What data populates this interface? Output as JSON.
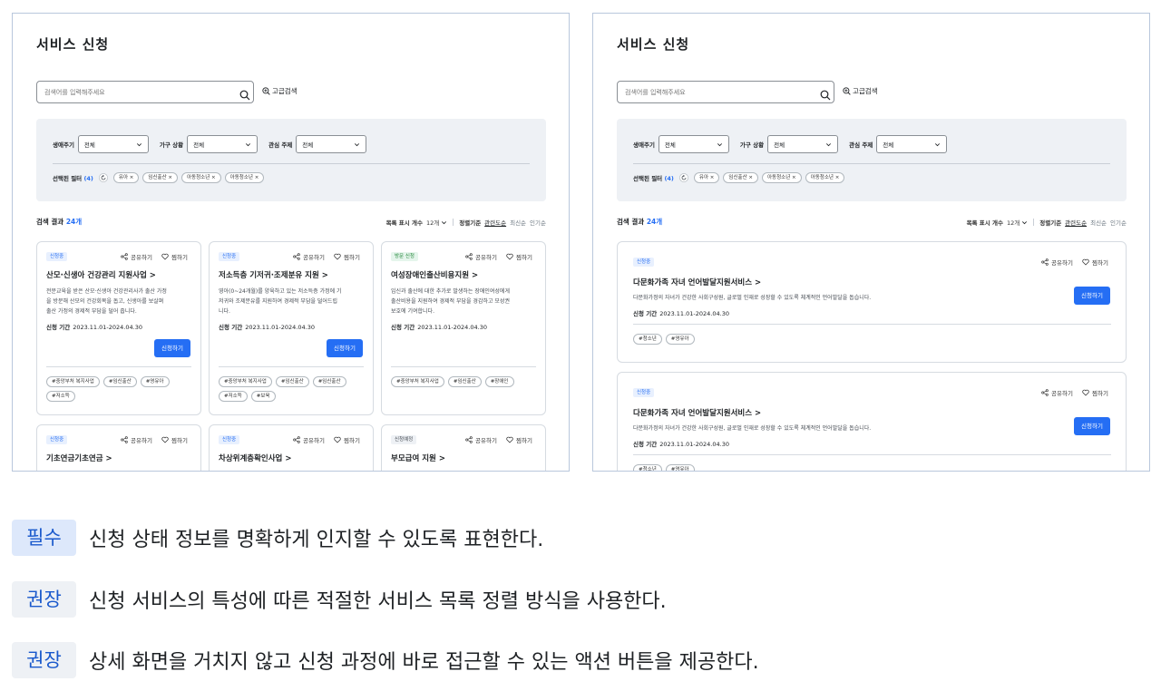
{
  "left": {
    "title": "서비스 신청",
    "search_placeholder": "검색어를 입력해주세요",
    "advanced_search": "고급검색",
    "filters": [
      {
        "label": "생애주기",
        "value": "전체"
      },
      {
        "label": "가구 상황",
        "value": "전체"
      },
      {
        "label": "관심 주제",
        "value": "전체"
      }
    ],
    "selected_label": "선택된 필터",
    "selected_count": "(4)",
    "chips": [
      "유아 ×",
      "임신출산 ×",
      "아동청소년 ×",
      "아동청소년 ×"
    ],
    "result_prefix": "검색 결과",
    "result_count": "24개",
    "per_page_label": "목록 표시 개수",
    "per_page_value": "12개",
    "sort_label": "정렬기준",
    "sort_options": [
      "관련도순",
      "최신순",
      "인기순"
    ],
    "share_label": "공유하기",
    "like_label": "찜하기",
    "apply_label": "신청하기",
    "period_label": "신청 기간",
    "cards": [
      {
        "status": "신청중",
        "title": "산모·신생아 건강관리 지원사업 >",
        "desc": [
          "전문교육을 받은 산모·신생아 건강관리사가 출산 가정",
          "을 방문해 산모의 건강회복을 돕고, 신생아를 보살펴",
          "출산 가정의 경제적 부담을 덜어 줍니다."
        ],
        "period": "2023.11.01-2024.04.30",
        "apply": true,
        "tags": [
          "#중앙부처 복지사업",
          "#임신출산",
          "#영유아",
          "#저소득"
        ]
      },
      {
        "status": "신청중",
        "title": "저소득층 기저귀·조제분유 지원 >",
        "desc": [
          "영아(0~24개월)를 양육하고 있는 저소득층 가정에 기",
          "저귀와 조제분유를 지원하여 경제적 부담을 덜어드립",
          "니다."
        ],
        "period": "2023.11.01-2024.04.30",
        "apply": true,
        "tags": [
          "#중앙부처 복지사업",
          "#임신출산",
          "#임신출산",
          "#저소득",
          "#보육"
        ]
      },
      {
        "status": "방문 신청",
        "title": "여성장애인출산비용지원 >",
        "desc": [
          "임신과 출산에 대한 추가로 발생하는 장애인여성에게",
          "출산비용을 지원하여 경제적 부담을 경감하고 모성권",
          "보호에 기여합니다."
        ],
        "period": "2023.11.01-2024.04.30",
        "apply": false,
        "tags": [
          "#중앙부처 복지사업",
          "#임신출산",
          "#장애인"
        ]
      },
      {
        "status": "신청중",
        "title": "기초연금기초연금 >"
      },
      {
        "status": "신청중",
        "title": "차상위계층확인사업 >"
      },
      {
        "status": "신청예정",
        "title": "부모급여 지원 >"
      }
    ]
  },
  "right": {
    "title": "서비스 신청",
    "search_placeholder": "검색어를 입력해주세요",
    "advanced_search": "고급검색",
    "filters": [
      {
        "label": "생애주기",
        "value": "전체"
      },
      {
        "label": "가구 상황",
        "value": "전체"
      },
      {
        "label": "관심 주제",
        "value": "전체"
      }
    ],
    "selected_label": "선택된 필터",
    "selected_count": "(4)",
    "chips": [
      "유아 ×",
      "임신출산 ×",
      "아동청소년 ×",
      "아동청소년 ×"
    ],
    "result_prefix": "검색 결과",
    "result_count": "24개",
    "per_page_label": "목록 표시 개수",
    "per_page_value": "12개",
    "sort_label": "정렬기준",
    "sort_options": [
      "관련도순",
      "최신순",
      "인기순"
    ],
    "share_label": "공유하기",
    "like_label": "찜하기",
    "apply_label": "신청하기",
    "period_label": "신청 기간",
    "cards": [
      {
        "status": "신청중",
        "title": "다문화가족 자녀 언어발달지원서비스 >",
        "desc": "다문화가정의 자녀가 건강한 사회구성원, 글로벌 인재로 성장할 수 있도록 체계적인 언어발달을 돕습니다.",
        "period": "2023.11.01-2024.04.30",
        "tags": [
          "#청소년",
          "#영유아"
        ]
      },
      {
        "status": "신청중",
        "title": "다문화가족 자녀 언어발달지원서비스 >",
        "desc": "다문화가정의 자녀가 건강한 사회구성원, 글로벌 인재로 성장할 수 있도록 체계적인 언어발달을 돕습니다.",
        "period": "2023.11.01-2024.04.30",
        "tags": [
          "#청소년",
          "#영유아"
        ]
      }
    ]
  },
  "criteria": [
    {
      "level": "필수",
      "text": "신청 상태 정보를 명확하게 인지할 수 있도록 표현한다."
    },
    {
      "level": "권장",
      "text": "신청 서비스의 특성에 따른 적절한 서비스 목록 정렬 방식을 사용한다."
    },
    {
      "level": "권장",
      "text": "상세 화면을 거치지 않고 신청 과정에 바로 접근할 수 있는 액션 버튼을 제공한다."
    }
  ],
  "colors": {
    "primary": "#256ef4",
    "panel_border": "#b9c7dc",
    "filter_bg": "#eef1f5",
    "must_bg": "#dde8fb"
  }
}
